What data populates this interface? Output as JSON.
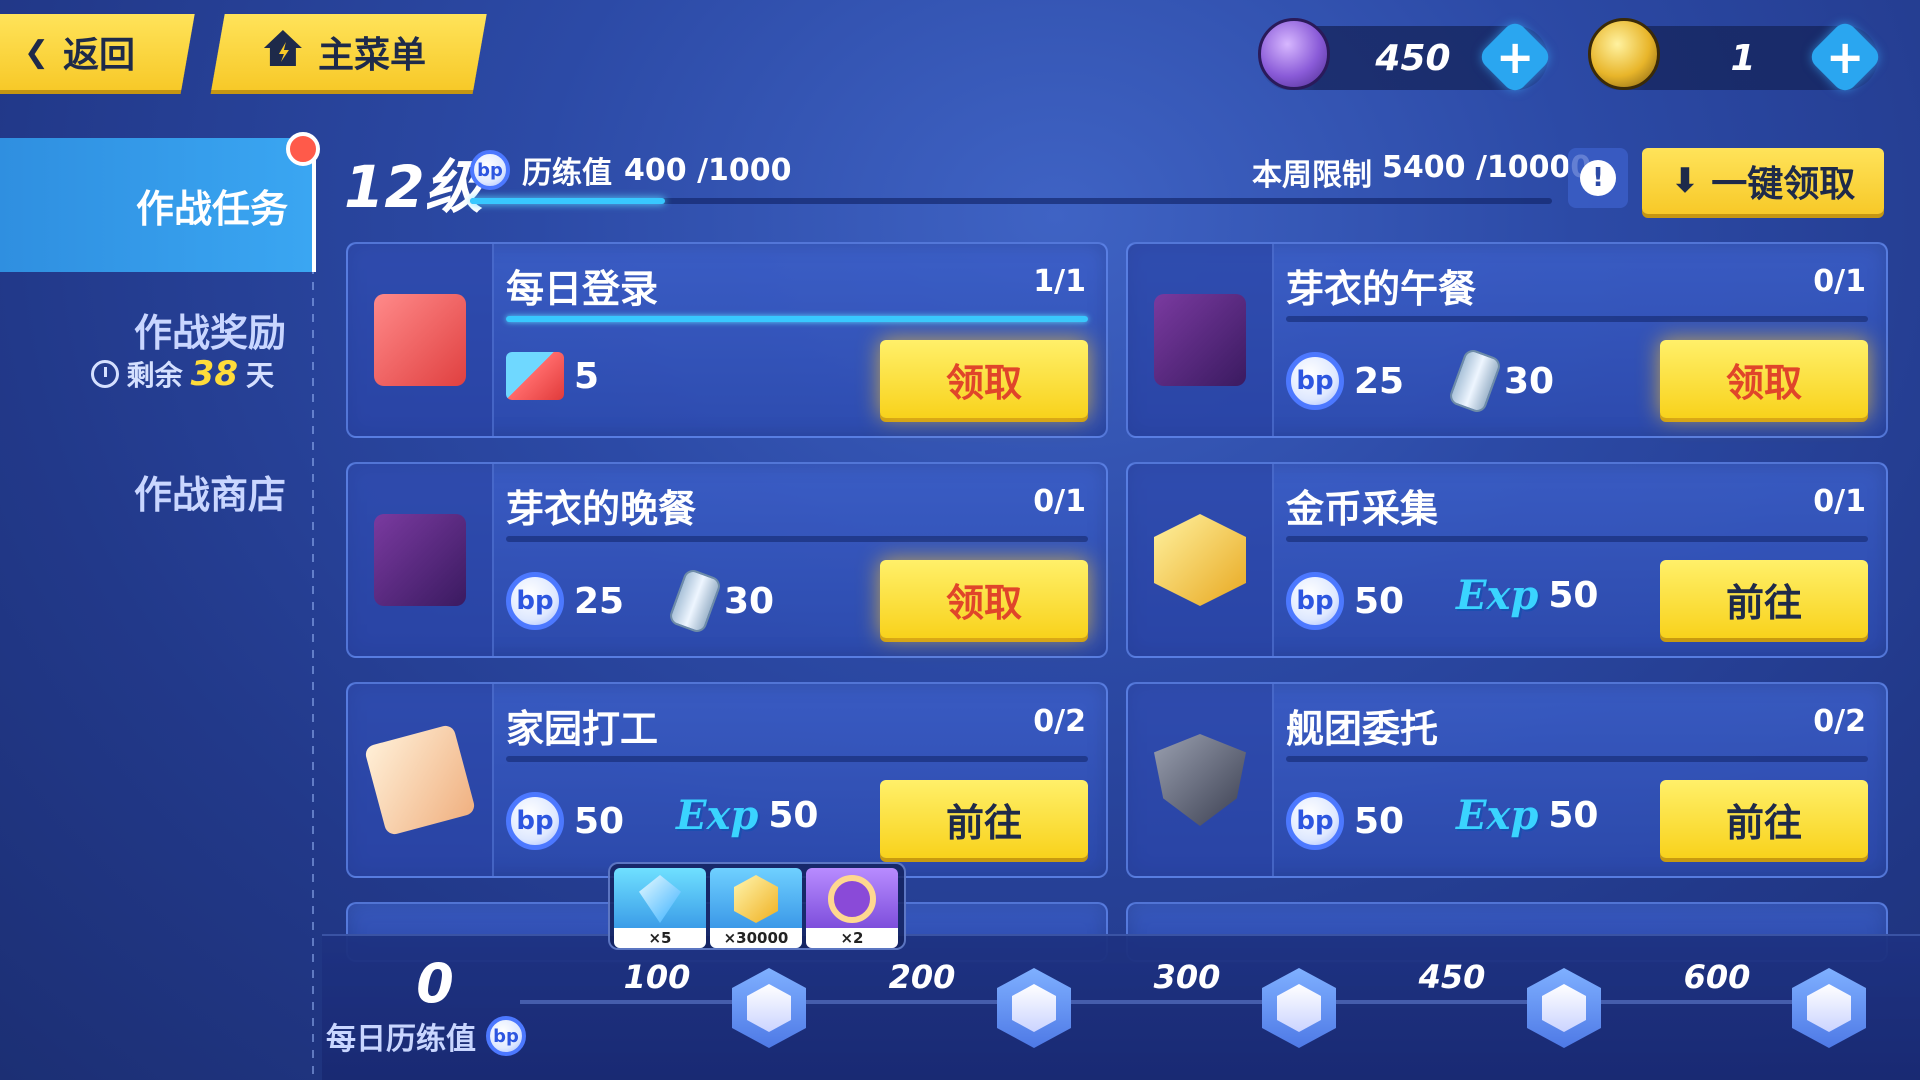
{
  "nav": {
    "back_label": "返回",
    "home_label": "主菜单"
  },
  "currency": [
    {
      "icon": "crystal-currency-icon",
      "value": "450"
    },
    {
      "icon": "gold-currency-icon",
      "value": "1"
    }
  ],
  "sidebar": {
    "items": [
      {
        "label": "作战任务",
        "active": true
      },
      {
        "label": "作战奖励",
        "sub_prefix": "剩余",
        "sub_value": "38",
        "sub_suffix": "天"
      },
      {
        "label": "作战商店"
      }
    ]
  },
  "level": {
    "level_text": "12级",
    "exp_label": "历练值",
    "exp_value": "400 /1000",
    "exp_progress": 0.4,
    "weekly_label": "本周限制",
    "weekly_value": "5400 /10000",
    "claim_all_label": "一键领取"
  },
  "tasks": [
    {
      "title": "每日登录",
      "progress": "1/1",
      "fill": 1.0,
      "rewards": [
        {
          "icon": "building-blocks-icon",
          "amount": "5"
        }
      ],
      "action": "领取",
      "claimable": true
    },
    {
      "title": "芽衣的午餐",
      "progress": "0/1",
      "fill": 0,
      "rewards": [
        {
          "icon": "bp-icon",
          "amount": "25"
        },
        {
          "icon": "drink-can-icon",
          "amount": "30"
        }
      ],
      "action": "领取",
      "claimable": true
    },
    {
      "title": "芽衣的晚餐",
      "progress": "0/1",
      "fill": 0,
      "rewards": [
        {
          "icon": "bp-icon",
          "amount": "25"
        },
        {
          "icon": "drink-can-icon",
          "amount": "30"
        }
      ],
      "action": "领取",
      "claimable": true
    },
    {
      "title": "金币采集",
      "progress": "0/1",
      "fill": 0,
      "rewards": [
        {
          "icon": "bp-icon",
          "amount": "50"
        },
        {
          "icon": "exp-icon",
          "amount": "50"
        }
      ],
      "action": "前往",
      "claimable": false
    },
    {
      "title": "家园打工",
      "progress": "0/2",
      "fill": 0,
      "rewards": [
        {
          "icon": "bp-icon",
          "amount": "50"
        },
        {
          "icon": "exp-icon",
          "amount": "50"
        }
      ],
      "action": "前往",
      "claimable": false
    },
    {
      "title": "舰团委托",
      "progress": "0/2",
      "fill": 0,
      "rewards": [
        {
          "icon": "bp-icon",
          "amount": "50"
        },
        {
          "icon": "exp-icon",
          "amount": "50"
        }
      ],
      "action": "前往",
      "claimable": false
    }
  ],
  "popup_rewards": [
    {
      "icon": "blue-crystal-icon",
      "qty": "×5"
    },
    {
      "icon": "gold-coin-icon",
      "qty": "×30000"
    },
    {
      "icon": "purple-emblem-icon",
      "qty": "×2"
    }
  ],
  "daily": {
    "value": "0",
    "label": "每日历练值",
    "milestones": [
      "100",
      "200",
      "300",
      "450",
      "600"
    ]
  },
  "icons": {
    "bp_text": "bp",
    "exp_text": "Exp",
    "plus": "+",
    "alert": "!",
    "back_arrow": "❮",
    "download": "⬇"
  },
  "colors": {
    "accent_yellow": "#f8d21c",
    "accent_blue": "#38c8ff",
    "claim_text": "#e0452a"
  }
}
